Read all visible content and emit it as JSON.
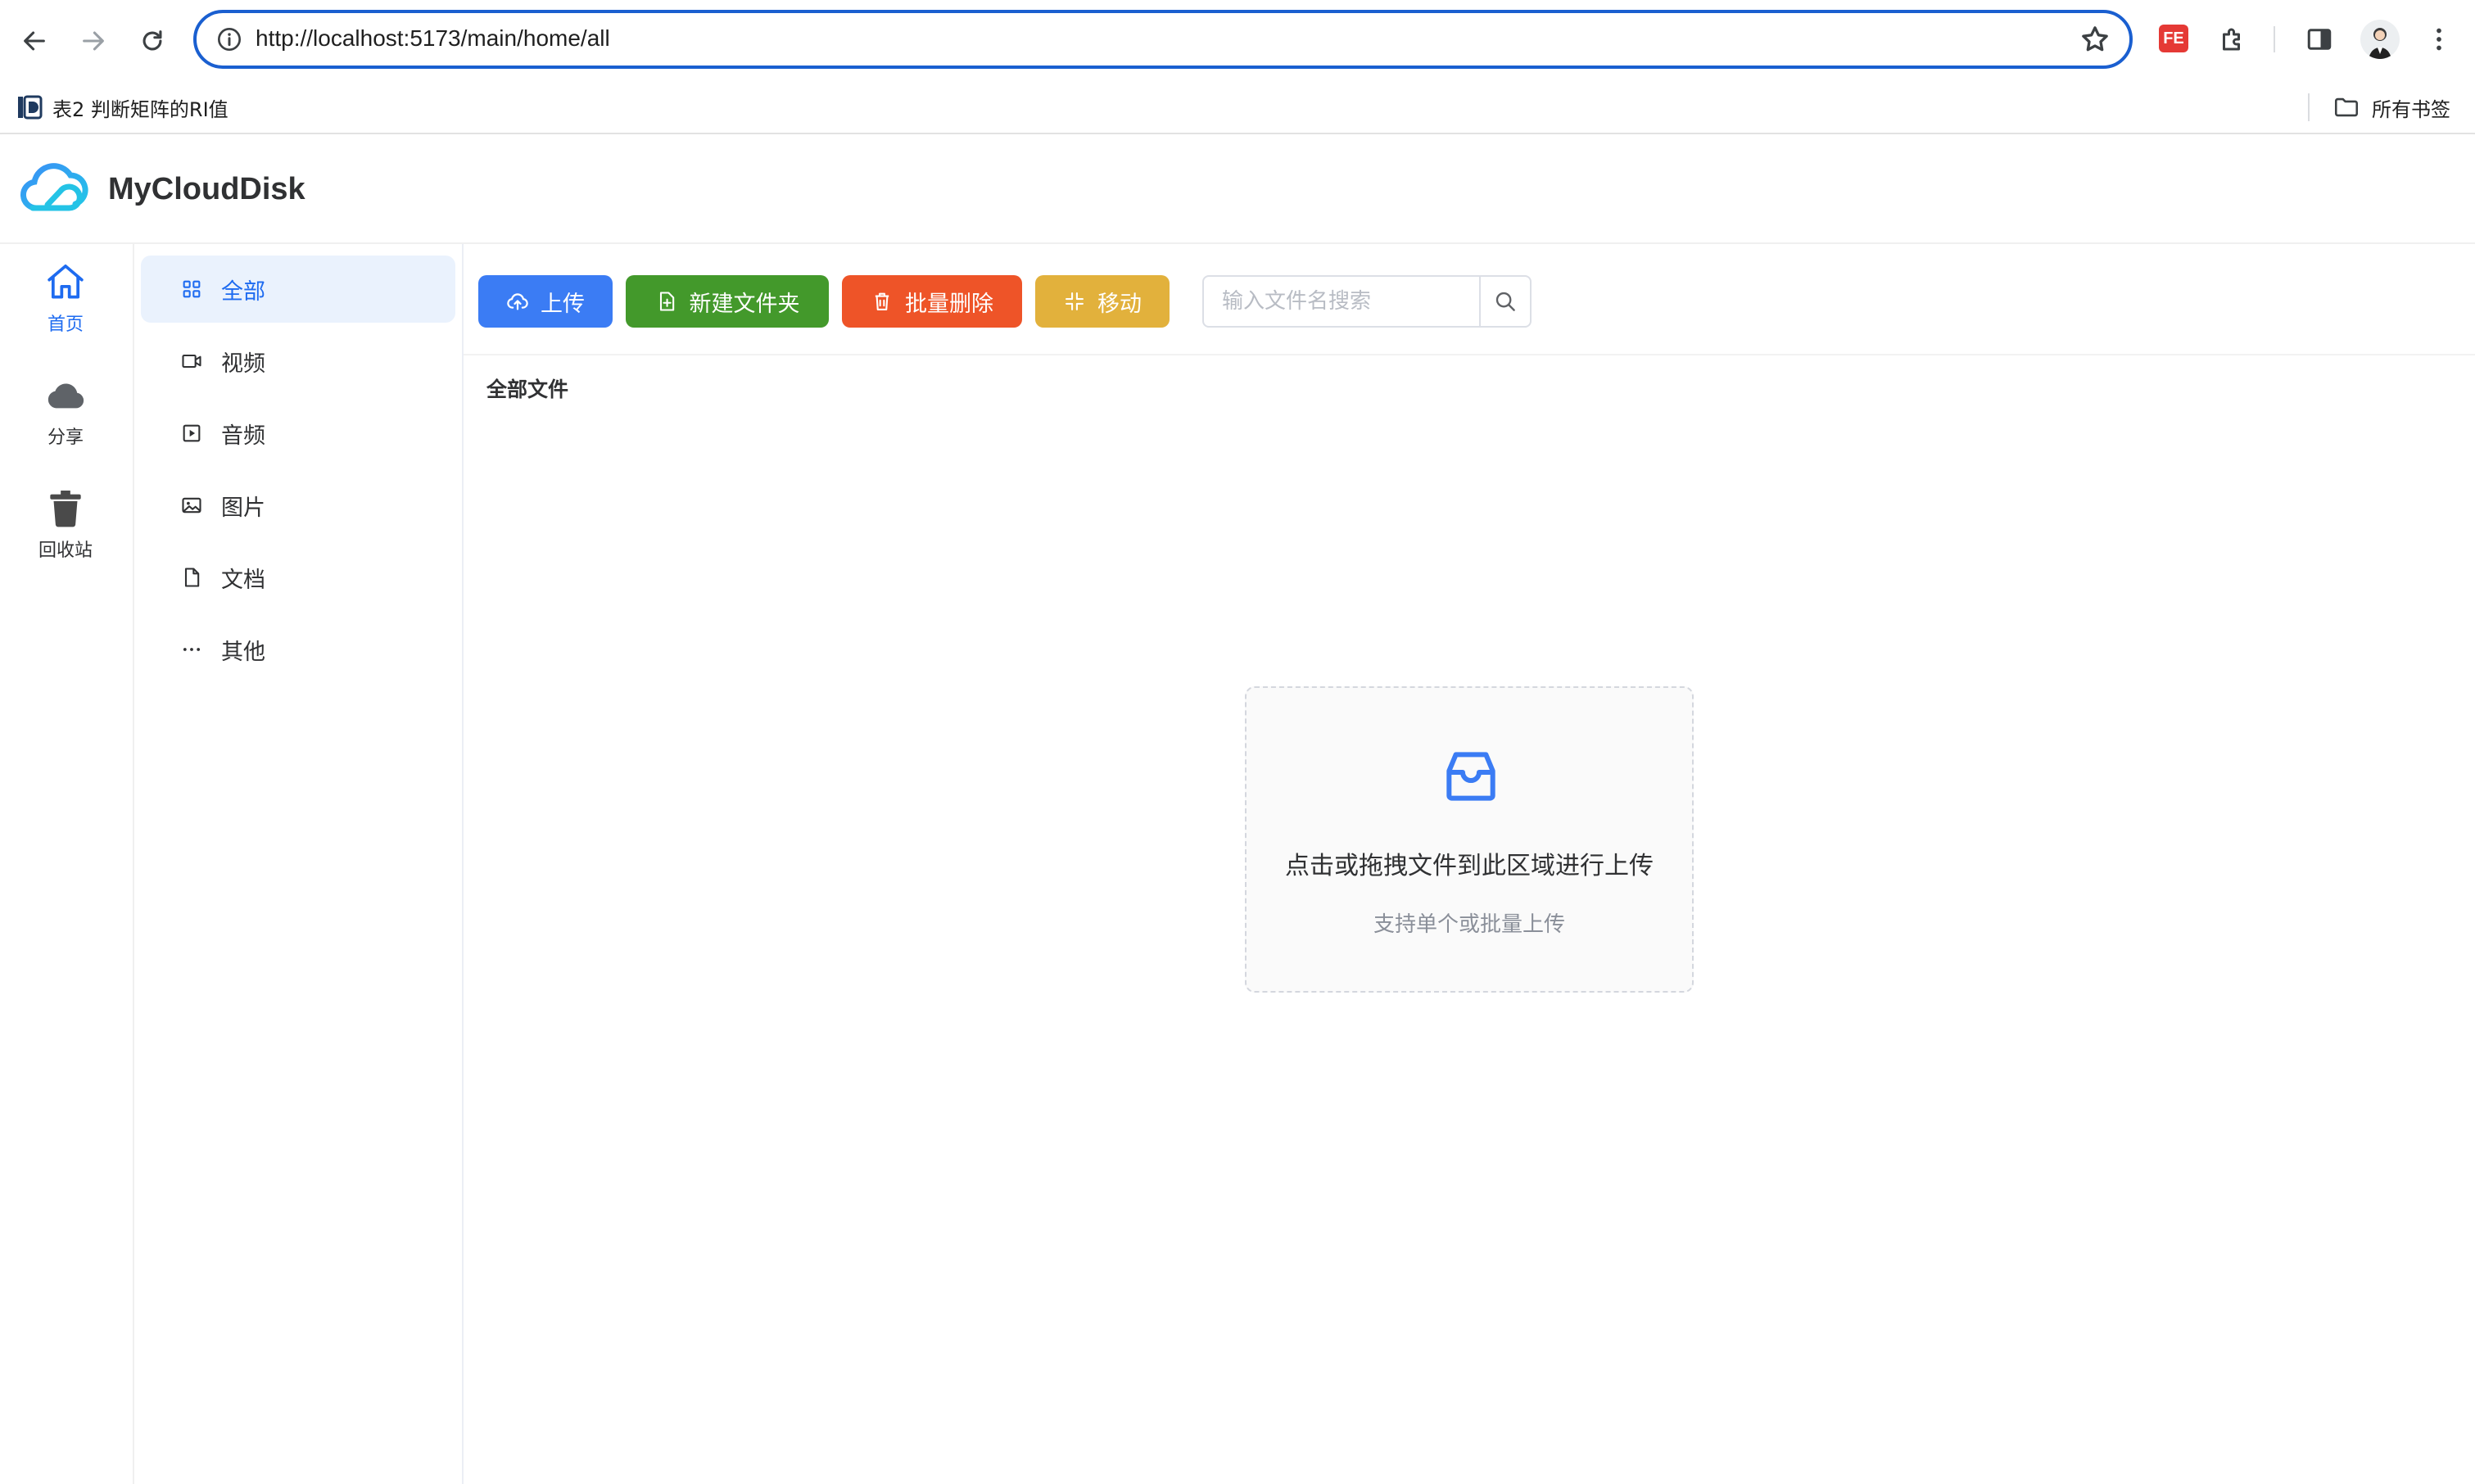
{
  "browser": {
    "url": "http://localhost:5173/main/home/all",
    "bookmark_item": "表2 判断矩阵的RI值",
    "all_bookmarks": "所有书签",
    "extension_label": "FE"
  },
  "app": {
    "title": "MyCloudDisk"
  },
  "rail": {
    "items": [
      {
        "label": "首页",
        "icon": "home-icon",
        "active": true
      },
      {
        "label": "分享",
        "icon": "cloud-icon",
        "active": false
      },
      {
        "label": "回收站",
        "icon": "trash-icon",
        "active": false
      }
    ]
  },
  "subnav": {
    "items": [
      {
        "label": "全部",
        "icon": "grid-icon",
        "active": true
      },
      {
        "label": "视频",
        "icon": "video-icon",
        "active": false
      },
      {
        "label": "音频",
        "icon": "audio-icon",
        "active": false
      },
      {
        "label": "图片",
        "icon": "image-icon",
        "active": false
      },
      {
        "label": "文档",
        "icon": "document-icon",
        "active": false
      },
      {
        "label": "其他",
        "icon": "more-icon",
        "active": false
      }
    ]
  },
  "toolbar": {
    "upload_label": "上传",
    "new_folder_label": "新建文件夹",
    "batch_delete_label": "批量删除",
    "move_label": "移动",
    "search_placeholder": "输入文件名搜索"
  },
  "main": {
    "breadcrumb": "全部文件",
    "dropzone_title": "点击或拖拽文件到此区域进行上传",
    "dropzone_subtitle": "支持单个或批量上传"
  },
  "colors": {
    "accent": "#1e6bf0",
    "upload": "#3b7cf4",
    "new_folder": "#43992b",
    "batch_delete": "#ee5428",
    "move": "#e2b13c"
  }
}
